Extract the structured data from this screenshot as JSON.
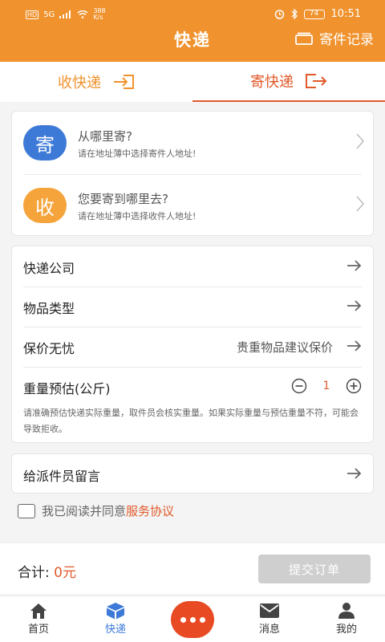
{
  "status_bar": {
    "hd": "HD",
    "net": "5G",
    "speed": "388\nK/s",
    "battery": "74",
    "time": "10:51"
  },
  "header": {
    "title": "快递",
    "record_label": "寄件记录"
  },
  "tabs": [
    {
      "label": "收快递",
      "active": false
    },
    {
      "label": "寄快递",
      "active": true
    }
  ],
  "address": {
    "sender": {
      "badge": "寄",
      "title": "从哪里寄?",
      "hint": "请在地址薄中选择寄件人地址!"
    },
    "receiver": {
      "badge": "收",
      "title": "您要寄到哪里去?",
      "hint": "请在地址薄中选择收件人地址!"
    }
  },
  "options": {
    "courier": {
      "label": "快递公司"
    },
    "item_type": {
      "label": "物品类型"
    },
    "insurance": {
      "label": "保价无忧",
      "hint": "贵重物品建议保价"
    },
    "weight": {
      "label": "重量预估(公斤)",
      "qty": "1",
      "note": "请准确预估快递实际重量，取件员会核实重量。如果实际重量与预估重量不符，可能会导致拒收。"
    }
  },
  "message": {
    "label": "给派件员留言"
  },
  "agreement": {
    "text": "我已阅读并同意",
    "link": "服务协议"
  },
  "footer": {
    "total_label": "合计:",
    "total_value": "0元",
    "submit_label": "提交订单"
  },
  "tabbar": [
    {
      "label": "首页",
      "icon": "home-icon"
    },
    {
      "label": "快递",
      "icon": "package-icon",
      "active": true
    },
    {
      "label": "",
      "icon": "more-icon"
    },
    {
      "label": "消息",
      "icon": "mail-icon"
    },
    {
      "label": "我的",
      "icon": "user-icon"
    }
  ],
  "colors": {
    "primary": "#f0922d",
    "accent": "#e05a2b",
    "blue": "#3d7ad8"
  }
}
